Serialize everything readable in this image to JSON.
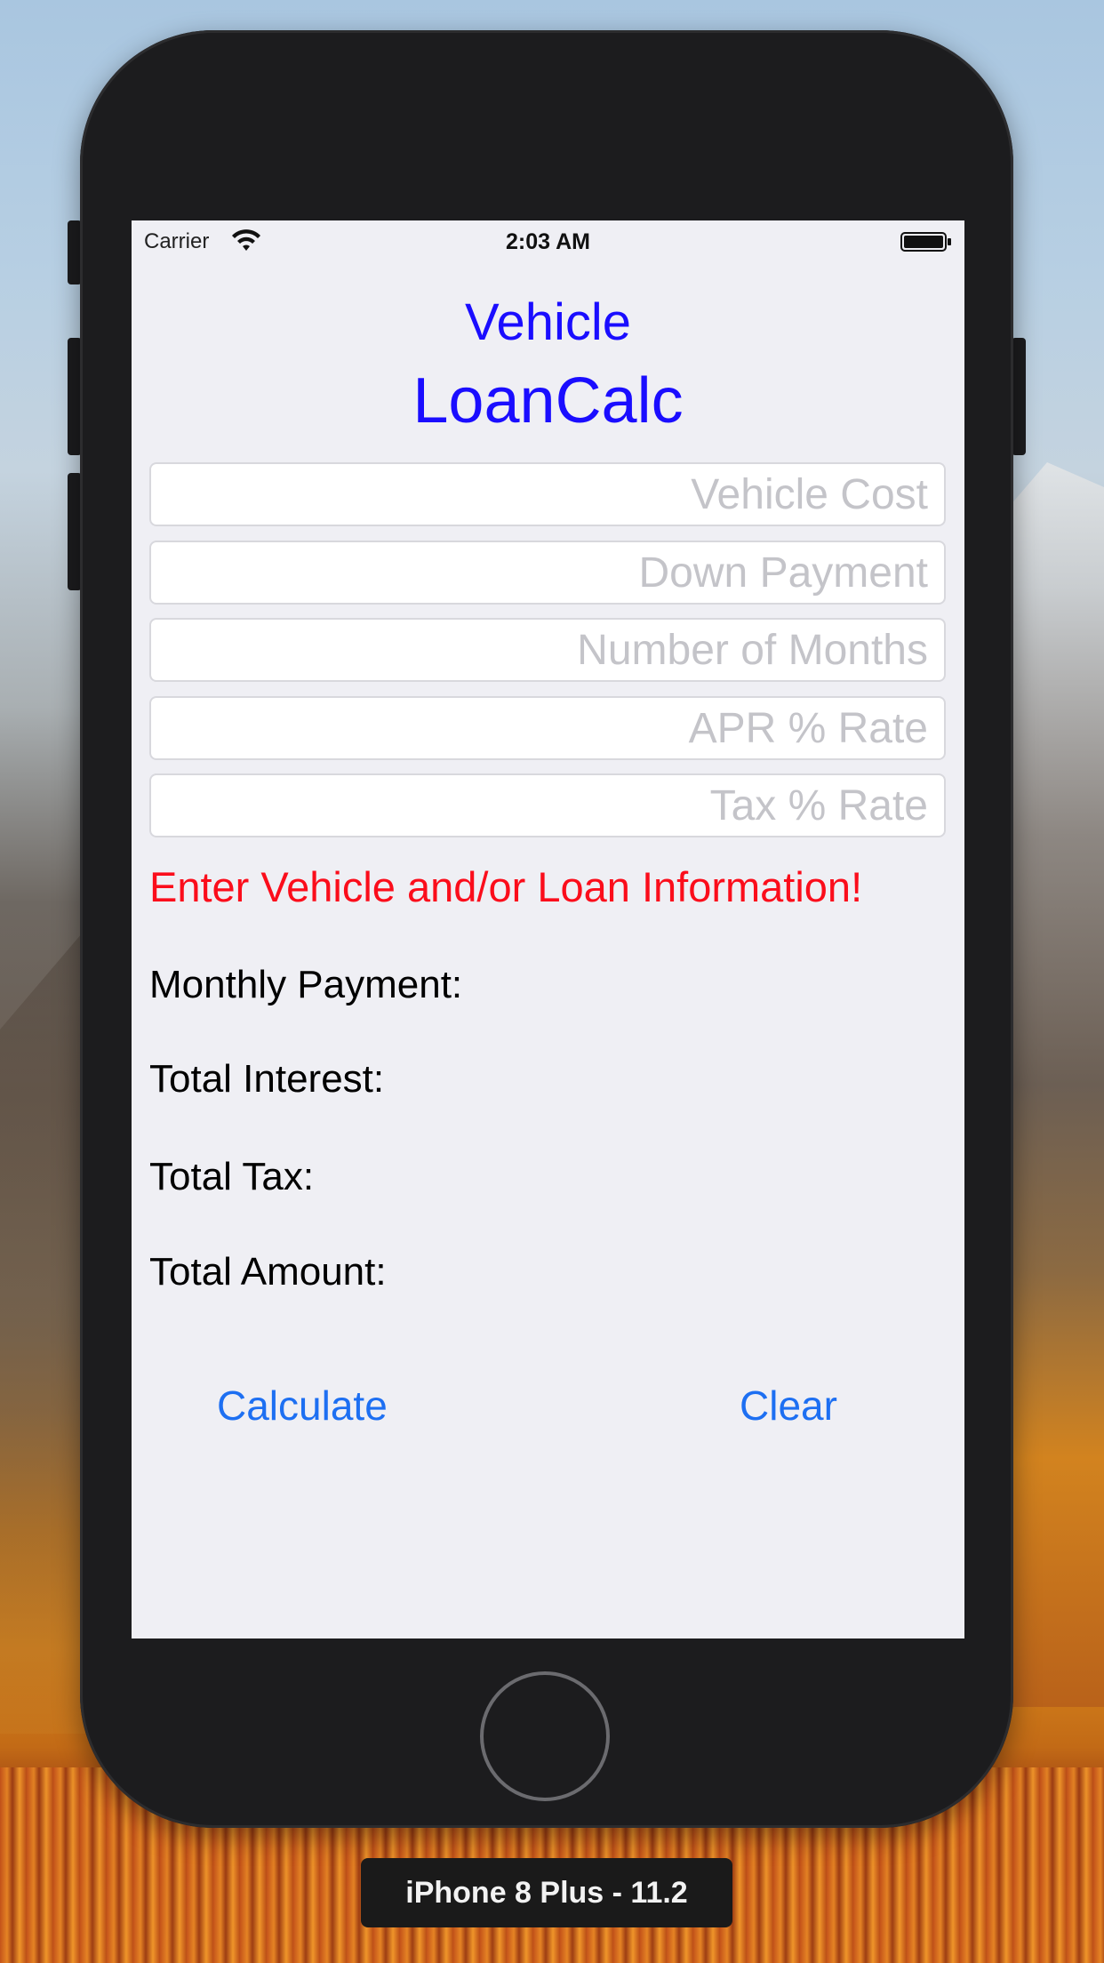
{
  "status_bar": {
    "carrier": "Carrier",
    "time": "2:03 AM",
    "wifi_icon": "wifi-icon",
    "battery_icon": "battery-icon"
  },
  "app": {
    "title_line1": "Vehicle",
    "title_line2": "LoanCalc",
    "title_color": "#1a0dff"
  },
  "inputs": {
    "vehicle_cost": {
      "placeholder": "Vehicle Cost",
      "value": ""
    },
    "down_payment": {
      "placeholder": "Down Payment",
      "value": ""
    },
    "number_of_months": {
      "placeholder": "Number of Months",
      "value": ""
    },
    "apr_rate": {
      "placeholder": "APR % Rate",
      "value": ""
    },
    "tax_rate": {
      "placeholder": "Tax % Rate",
      "value": ""
    }
  },
  "message": {
    "text": "Enter Vehicle and/or Loan Information!",
    "color": "#fb0d1b"
  },
  "results": {
    "monthly_payment_label": "Monthly Payment:",
    "total_interest_label": "Total Interest:",
    "total_tax_label": "Total Tax:",
    "total_amount_label": "Total Amount:"
  },
  "actions": {
    "calculate_label": "Calculate",
    "clear_label": "Clear",
    "color": "#1d6ff2"
  },
  "simulator": {
    "device_label": "iPhone 8 Plus - 11.2"
  }
}
